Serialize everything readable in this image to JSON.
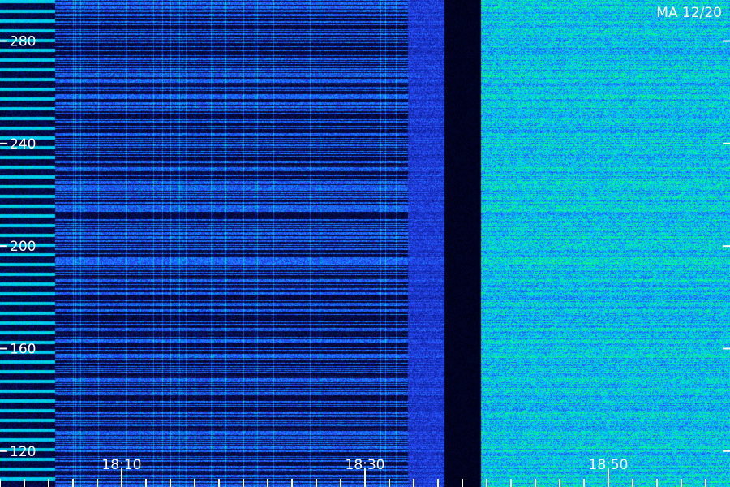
{
  "station_label": "MA 12/20",
  "chart_data": {
    "type": "heatmap",
    "title": "",
    "xlabel": "",
    "ylabel": "",
    "x_ticks": [
      {
        "label": "18:10",
        "minutes_after_1800": 10
      },
      {
        "label": "18:30",
        "minutes_after_1800": 30
      },
      {
        "label": "18:50",
        "minutes_after_1800": 50
      }
    ],
    "x_range_minutes_after_1800": [
      0.0,
      60.0
    ],
    "y_ticks": [
      120,
      160,
      200,
      240,
      280
    ],
    "y_range": [
      106,
      296
    ],
    "grid": false,
    "colormap": [
      "#000010",
      "#0a1a8c",
      "#2a4dff",
      "#00c8ff",
      "#00ff80",
      "#40ff40"
    ],
    "regions": [
      {
        "x_start": 0.0,
        "x_end": 4.5,
        "intensity": 0.55,
        "pattern": "striped"
      },
      {
        "x_start": 4.5,
        "x_end": 33.5,
        "intensity": 0.3,
        "pattern": "sparse"
      },
      {
        "x_start": 33.5,
        "x_end": 36.5,
        "intensity": 0.45,
        "pattern": "dense"
      },
      {
        "x_start": 36.5,
        "x_end": 39.5,
        "intensity": 0.05,
        "pattern": "quiet"
      },
      {
        "x_start": 39.5,
        "x_end": 60.0,
        "intensity": 0.85,
        "pattern": "dense"
      }
    ]
  }
}
